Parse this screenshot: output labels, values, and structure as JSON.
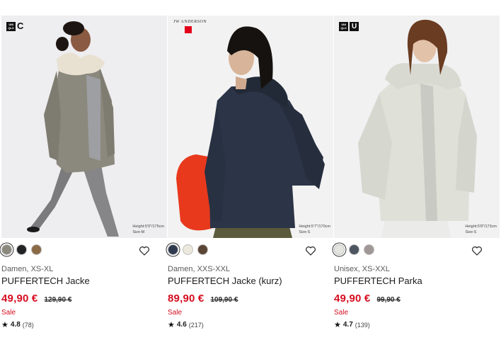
{
  "products": [
    {
      "brand_mark": "C",
      "height_info": [
        "Height:5'9\"/175cm",
        "Size:M"
      ],
      "swatches": [
        "#8b887d",
        "#222325",
        "#8b6a46"
      ],
      "meta": "Damen, XS-XL",
      "name": "PUFFERTECH Jacke",
      "price": "49,90 €",
      "old_price": "129,90 €",
      "sale": "Sale",
      "rating": "4.8",
      "reviews": "(78)"
    },
    {
      "brand_mark": "JW ANDERSON",
      "height_info": [
        "Height:5'7\"/170cm",
        "Size:S"
      ],
      "swatches": [
        "#2f3a4f",
        "#ece8de",
        "#5b4535"
      ],
      "meta": "Damen, XXS-XXL",
      "name": "PUFFERTECH Jacke (kurz)",
      "price": "89,90 €",
      "old_price": "109,90 €",
      "sale": "Sale",
      "rating": "4.6",
      "reviews": "(217)"
    },
    {
      "brand_mark": "U",
      "height_info": [
        "Height:5'8\"/173cm",
        "Size:S"
      ],
      "swatches": [
        "#e5e5df",
        "#4c5560",
        "#a09896"
      ],
      "meta": "Unisex, XS-XXL",
      "name": "PUFFERTECH Parka",
      "price": "49,90 €",
      "old_price": "99,90 €",
      "sale": "Sale",
      "rating": "4.7",
      "reviews": "(139)"
    }
  ],
  "logo_text": [
    "UNI",
    "QLO"
  ],
  "icons": {
    "favorite": "heart-outline-icon",
    "rating": "star-icon"
  },
  "colors": {
    "sale_red": "#d60d1f",
    "text": "#1b1b1b"
  }
}
